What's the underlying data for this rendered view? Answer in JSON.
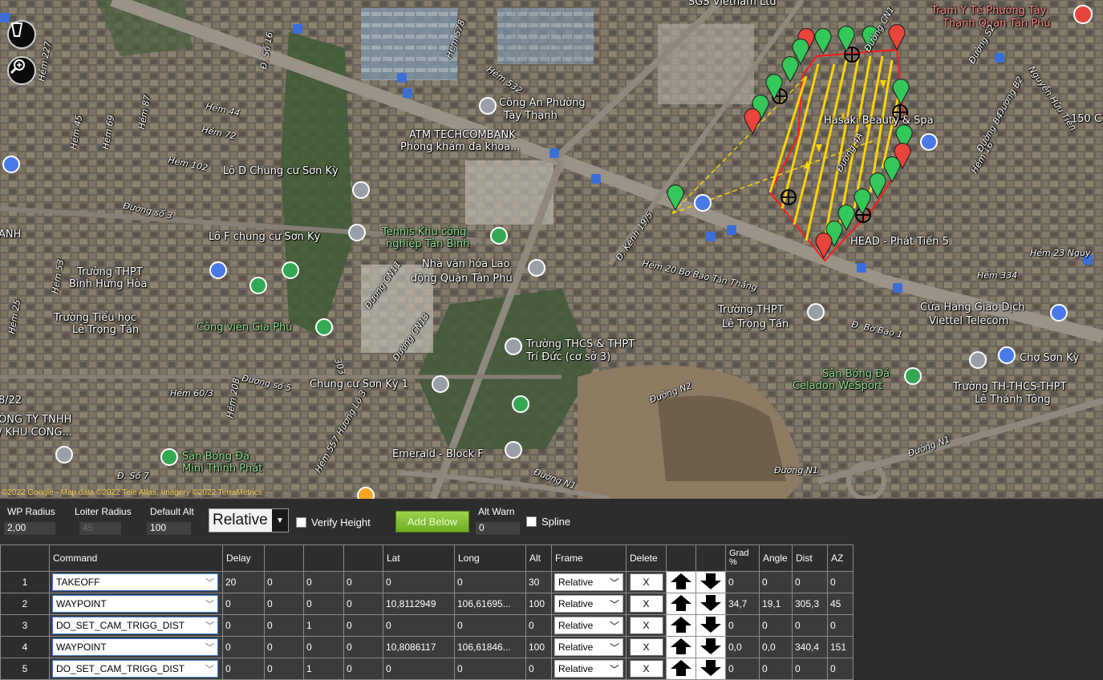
{
  "map": {
    "attribution": "©2022 Google - Map data ©2022 Tele Atlas, Imagery ©2022 TerraMetrics",
    "labels": [
      {
        "text": "SGS Vietnam Ltd",
        "cls": ""
      },
      {
        "text": "Trạm Y Tế Phường Tây",
        "cls": "red"
      },
      {
        "text": "Thạnh Quận Tân Phú",
        "cls": "red"
      },
      {
        "text": "Công An Phường",
        "cls": ""
      },
      {
        "text": "Tây Thạnh",
        "cls": ""
      },
      {
        "text": "ATM TECHCOMBANK",
        "cls": ""
      },
      {
        "text": "Phòng khám đa khoa...",
        "cls": ""
      },
      {
        "text": "Hasaki Beauty & Spa",
        "cls": ""
      },
      {
        "text": "Lô D Chung cư Sơn Kỳ",
        "cls": ""
      },
      {
        "text": "Lô F chung cư Sơn Kỳ",
        "cls": ""
      },
      {
        "text": "Tennis Khu công",
        "cls": "green"
      },
      {
        "text": "nghiệp Tân Bình",
        "cls": "green"
      },
      {
        "text": "Nhà văn hóa Lao",
        "cls": ""
      },
      {
        "text": "động Quận Tân Phú",
        "cls": ""
      },
      {
        "text": "Trường THPT",
        "cls": ""
      },
      {
        "text": "Bình Hưng Hòa",
        "cls": ""
      },
      {
        "text": "Trường Tiểu học",
        "cls": ""
      },
      {
        "text": "Lê Trọng Tấn",
        "cls": ""
      },
      {
        "text": "Công viên Gia Phú",
        "cls": "green"
      },
      {
        "text": "HEAD - Phát Tiến 5",
        "cls": ""
      },
      {
        "text": "Trường THPT",
        "cls": ""
      },
      {
        "text": "Lê Trọng Tấn",
        "cls": ""
      },
      {
        "text": "Cửa Hàng Giao Dịch",
        "cls": ""
      },
      {
        "text": "Viettel Telecom",
        "cls": ""
      },
      {
        "text": "Trường THCS & THPT",
        "cls": ""
      },
      {
        "text": "Trí Đức (cơ sở 3)",
        "cls": ""
      },
      {
        "text": "Chợ Sơn Kỳ",
        "cls": ""
      },
      {
        "text": "Sân Bóng Đá",
        "cls": "green"
      },
      {
        "text": "Celadon WeSport",
        "cls": "green"
      },
      {
        "text": "Trường TH-THCS-THPT",
        "cls": ""
      },
      {
        "text": "Lê Thánh Tông",
        "cls": ""
      },
      {
        "text": "Chung cư Sơn Kỳ 1",
        "cls": ""
      },
      {
        "text": "Sân Bóng Đá",
        "cls": "green"
      },
      {
        "text": "Mini Thịnh Phát",
        "cls": "green"
      },
      {
        "text": "Emerald - Block F",
        "cls": ""
      },
      {
        "text": "ÔNG TY TNHH",
        "cls": ""
      },
      {
        "text": "/ KHU CÔNG...",
        "cls": ""
      },
      {
        "text": "ANH",
        "cls": ""
      },
      {
        "text": "8/22",
        "cls": ""
      },
      {
        "text": "150 C",
        "cls": ""
      }
    ],
    "road_labels": [
      "Hẻm 44",
      "Hẻm 72",
      "Hẻm 102",
      "Đường số 3",
      "Hẻm 532",
      "Hẻm 578",
      "Đ. Số 16",
      "Hẻm 227",
      "Hẻm 45",
      "Hẻm 69",
      "Hẻm 87",
      "Hẻm 53",
      "Hẻm 25",
      "Đường số 5",
      "Hẻm 60/3",
      "Hẻm 208",
      "Đ. Số 7",
      "Đường CN11",
      "Đường CN13",
      "303",
      "Đ. Kênh 19/5",
      "Hẻm 20 Bờ Bao Tân Thắng",
      "Hẻm 334",
      "Đ. Bờ Bao 1",
      "Đường N2",
      "Đường N1",
      "Đường N1",
      "Đường N1",
      "Hẻm 16",
      "Đường B2",
      "Đường B4",
      "Đường S2",
      "Hẻm 23 Nguy",
      "Nguyễn Hữu Tiến",
      "Đường CN1",
      "Hẻm 557 Hương Lộ 3",
      "Đường 4A"
    ]
  },
  "options": {
    "wp_radius_label": "WP Radius",
    "wp_radius_value": "2,00",
    "loiter_radius_label": "Loiter Radius",
    "loiter_radius_value": "45",
    "default_alt_label": "Default Alt",
    "default_alt_value": "100",
    "frame_select": "Relative",
    "verify_height_label": "Verify Height",
    "add_below_label": "Add Below",
    "alt_warn_label": "Alt Warn",
    "alt_warn_value": "0",
    "spline_label": "Spline"
  },
  "grid": {
    "headers": [
      "",
      "Command",
      "Delay",
      "",
      "",
      "",
      "Lat",
      "Long",
      "Alt",
      "Frame",
      "Delete",
      "",
      "",
      "Grad %",
      "Angle",
      "Dist",
      "AZ"
    ],
    "rows": [
      {
        "num": "1",
        "command": "TAKEOFF",
        "delay": "20",
        "p2": "0",
        "p3": "0",
        "p4": "0",
        "lat": "0",
        "long": "0",
        "alt": "30",
        "frame": "Relative",
        "delete": "X",
        "grad": "0",
        "angle": "0",
        "dist": "0",
        "az": "0"
      },
      {
        "num": "2",
        "command": "WAYPOINT",
        "delay": "0",
        "p2": "0",
        "p3": "0",
        "p4": "0",
        "lat": "10,8112949",
        "long": "106,61695...",
        "alt": "100",
        "frame": "Relative",
        "delete": "X",
        "grad": "34,7",
        "angle": "19,1",
        "dist": "305,3",
        "az": "45"
      },
      {
        "num": "3",
        "command": "DO_SET_CAM_TRIGG_DIST",
        "delay": "0",
        "p2": "0",
        "p3": "1",
        "p4": "0",
        "lat": "0",
        "long": "0",
        "alt": "0",
        "frame": "Relative",
        "delete": "X",
        "grad": "0",
        "angle": "0",
        "dist": "0",
        "az": "0"
      },
      {
        "num": "4",
        "command": "WAYPOINT",
        "delay": "0",
        "p2": "0",
        "p3": "0",
        "p4": "0",
        "lat": "10,8086117",
        "long": "106,61846...",
        "alt": "100",
        "frame": "Relative",
        "delete": "X",
        "grad": "0,0",
        "angle": "0,0",
        "dist": "340,4",
        "az": "151"
      },
      {
        "num": "5",
        "command": "DO_SET_CAM_TRIGG_DIST",
        "delay": "0",
        "p2": "0",
        "p3": "1",
        "p4": "0",
        "lat": "0",
        "long": "0",
        "alt": "0",
        "frame": "Relative",
        "delete": "X",
        "grad": "0",
        "angle": "0",
        "dist": "0",
        "az": "0"
      }
    ]
  }
}
